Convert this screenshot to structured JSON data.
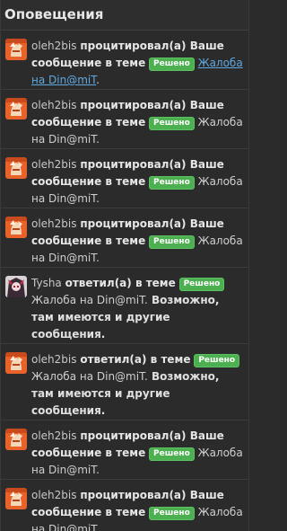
{
  "header": {
    "title": "Оповещения"
  },
  "colors": {
    "badge": "#4caf50",
    "link": "#5fa8e0",
    "avatar_orange": "#e8622a"
  },
  "items": [
    {
      "avatar": "oleh-avatar",
      "user": "oleh2bis",
      "action": "процитировал(а) Ваше сообщение в теме",
      "badge": "Решено",
      "thread": "Жалоба на Din@miT",
      "tail": ".",
      "extra": "",
      "hovered": true
    },
    {
      "avatar": "oleh-avatar",
      "user": "oleh2bis",
      "action": "процитировал(а) Ваше сообщение в теме",
      "badge": "Решено",
      "thread": "Жалоба на Din@miT",
      "tail": ".",
      "extra": ""
    },
    {
      "avatar": "oleh-avatar",
      "user": "oleh2bis",
      "action": "процитировал(а) Ваше сообщение в теме",
      "badge": "Решено",
      "thread": "Жалоба на Din@miT",
      "tail": ".",
      "extra": ""
    },
    {
      "avatar": "oleh-avatar",
      "user": "oleh2bis",
      "action": "процитировал(а) Ваше сообщение в теме",
      "badge": "Решено",
      "thread": "Жалоба на Din@miT",
      "tail": ".",
      "extra": ""
    },
    {
      "avatar": "tysha-avatar",
      "user": "Tysha",
      "action": "ответил(а) в теме",
      "badge": "Решено",
      "thread": "Жалоба на Din@miT",
      "tail": ".",
      "extra": " Возможно, там имеются и другие сообщения."
    },
    {
      "avatar": "oleh-avatar",
      "user": "oleh2bis",
      "action": "ответил(а) в теме",
      "badge": "Решено",
      "thread": "Жалоба на Din@miT",
      "tail": ".",
      "extra": " Возможно, там имеются и другие сообщения."
    },
    {
      "avatar": "oleh-avatar",
      "user": "oleh2bis",
      "action": "процитировал(а) Ваше сообщение в теме",
      "badge": "Решено",
      "thread": "Жалоба на Din@miT",
      "tail": ".",
      "extra": ""
    },
    {
      "avatar": "oleh-avatar",
      "user": "oleh2bis",
      "action": "процитировал(а) Ваше сообщение в теме",
      "badge": "Решено",
      "thread": "Жалоба на Din@miT",
      "tail": ".",
      "extra": ""
    }
  ]
}
